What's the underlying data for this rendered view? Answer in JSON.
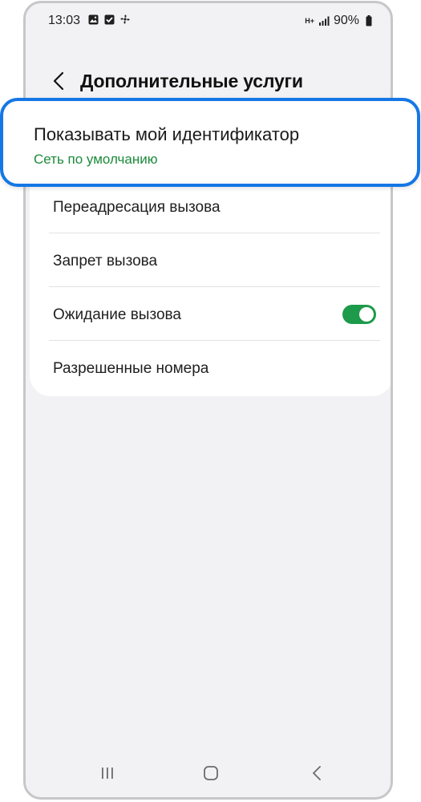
{
  "status_bar": {
    "time": "13:03",
    "battery": "90%",
    "network": "H+",
    "icons": [
      "image-icon",
      "checkbox-icon",
      "fan-icon",
      "data-arrows-icon",
      "signal-icon",
      "battery-icon"
    ]
  },
  "header": {
    "title": "Дополнительные услуги",
    "back_icon": "chevron-left-icon"
  },
  "highlighted_item": {
    "title": "Показывать мой идентификатор",
    "subtitle": "Сеть по умолчанию"
  },
  "list": {
    "items": [
      {
        "label": "Переадресация вызова"
      },
      {
        "label": "Запрет вызова"
      },
      {
        "label": "Ожидание вызова",
        "toggle": true
      },
      {
        "label": "Разрешенные номера"
      }
    ]
  },
  "nav_bar": {
    "icons": [
      "recents-icon",
      "home-icon",
      "back-icon"
    ]
  },
  "colors": {
    "accent_blue": "#1577e6",
    "subtitle_green": "#1b8a3a",
    "toggle_on": "#1d9a4a",
    "background": "#f2f2f4"
  }
}
